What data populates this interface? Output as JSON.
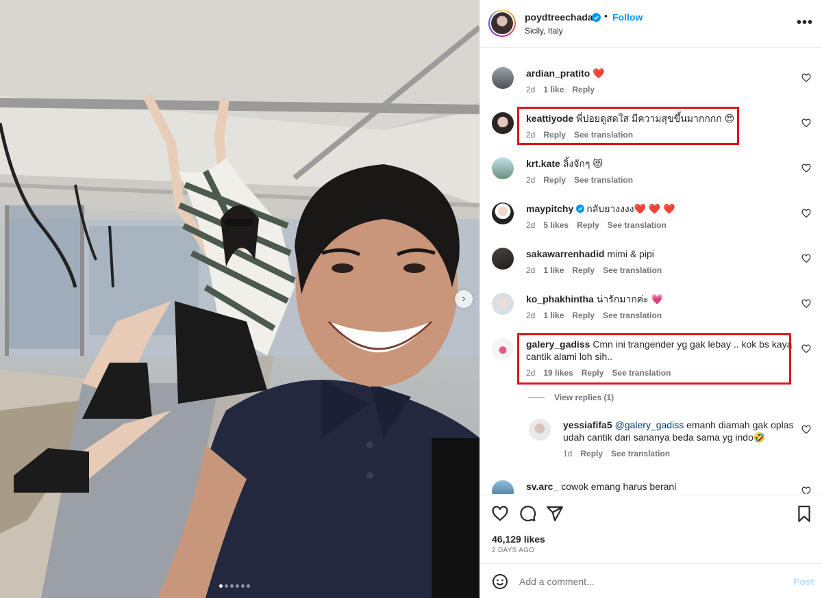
{
  "post": {
    "username": "poydtreechada",
    "follow_label": "Follow",
    "separator": "•",
    "location": "Sicily, Italy",
    "more_label": "•••",
    "carousel_next": "›",
    "carousel_dots": 6,
    "carousel_active": 0
  },
  "comments": [
    {
      "user": "ardian_pratito",
      "text": "❤️",
      "age": "2d",
      "likes": "1 like",
      "reply": "Reply",
      "translation": ""
    },
    {
      "user": "keattiyode",
      "text": "พี่ปอยดูสดใส มีความสุขขึ้นมากกกก 😍",
      "age": "2d",
      "likes": "",
      "reply": "Reply",
      "translation": "See translation"
    },
    {
      "user": "krt.kate",
      "text": "ลิ้งจักๆ 😻",
      "age": "2d",
      "likes": "",
      "reply": "Reply",
      "translation": "See translation"
    },
    {
      "user": "maypitchy",
      "text": "กลับยางงงง❤️ ❤️ ❤️",
      "age": "2d",
      "likes": "5 likes",
      "reply": "Reply",
      "translation": "See translation"
    },
    {
      "user": "sakawarrenhadid",
      "text": "mimi & pipi",
      "age": "2d",
      "likes": "1 like",
      "reply": "Reply",
      "translation": "See translation"
    },
    {
      "user": "ko_phakhintha",
      "text": "น่ารักมากค่ะ 💗",
      "age": "2d",
      "likes": "1 like",
      "reply": "Reply",
      "translation": "See translation"
    },
    {
      "user": "galery_gadiss",
      "text": "Cmn ini trangender yg gak lebay .. kok bs kaya cantik alami loh sih..",
      "age": "2d",
      "likes": "19 likes",
      "reply": "Reply",
      "translation": "See translation"
    }
  ],
  "view_replies": "View replies (1)",
  "reply": {
    "user": "yessiafifa5",
    "mention": "@galery_gadiss",
    "text": "emanh diamah gak oplas udah cantik dari sananya beda sama yg indo🤣",
    "age": "1d",
    "reply": "Reply",
    "translation": "See translation"
  },
  "last_comment": {
    "user": "sv.arc_",
    "text": "cowok emang harus berani"
  },
  "likes_count": "46,129 likes",
  "post_date": "2 DAYS AGO",
  "add_comment": {
    "placeholder": "Add a comment...",
    "post_label": "Post"
  },
  "colors": {
    "accent": "#0095f6",
    "highlight": "#e0141e",
    "heart": "#ed4956"
  }
}
